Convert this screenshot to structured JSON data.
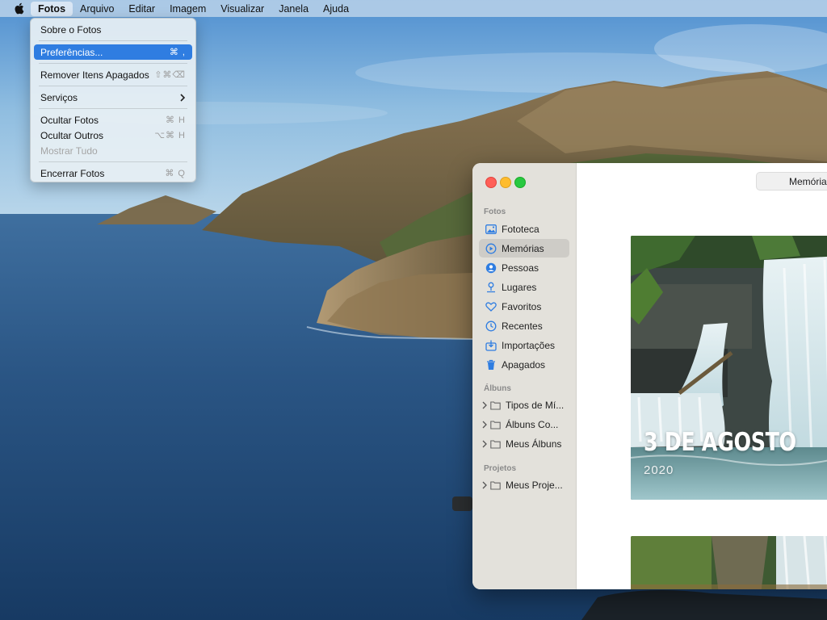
{
  "menubar": {
    "app_name": "Fotos",
    "items": [
      "Arquivo",
      "Editar",
      "Imagem",
      "Visualizar",
      "Janela",
      "Ajuda"
    ]
  },
  "app_menu": {
    "items": [
      {
        "label": "Sobre o Fotos",
        "shortcut": ""
      },
      {
        "label": "Preferências...",
        "shortcut": "⌘ ,",
        "state": "highlighted"
      },
      {
        "label": "Remover Itens Apagados",
        "shortcut": "⇧⌘⌫"
      },
      {
        "label": "Serviços",
        "submenu": true
      },
      {
        "label": "Ocultar Fotos",
        "shortcut": "⌘ H"
      },
      {
        "label": "Ocultar Outros",
        "shortcut": "⌥⌘ H"
      },
      {
        "label": "Mostrar Tudo",
        "shortcut": "",
        "state": "disabled"
      },
      {
        "label": "Encerrar Fotos",
        "shortcut": "⌘ Q"
      }
    ]
  },
  "sidebar": {
    "section_photos": "Fotos",
    "photos_items": [
      {
        "label": "Fototeca",
        "icon": "photo-library-icon"
      },
      {
        "label": "Memórias",
        "icon": "memories-icon",
        "selected": true
      },
      {
        "label": "Pessoas",
        "icon": "people-icon"
      },
      {
        "label": "Lugares",
        "icon": "places-pin-icon"
      },
      {
        "label": "Favoritos",
        "icon": "heart-icon"
      },
      {
        "label": "Recentes",
        "icon": "clock-icon"
      },
      {
        "label": "Importações",
        "icon": "import-icon"
      },
      {
        "label": "Apagados",
        "icon": "trash-icon"
      }
    ],
    "section_albums": "Álbuns",
    "album_items": [
      {
        "label": "Tipos de Mí...",
        "icon": "folder-icon"
      },
      {
        "label": "Álbuns Co...",
        "icon": "folder-icon"
      },
      {
        "label": "Meus Álbuns",
        "icon": "folder-icon"
      }
    ],
    "section_projects": "Projetos",
    "project_items": [
      {
        "label": "Meus Proje...",
        "icon": "folder-icon"
      }
    ]
  },
  "content": {
    "segmented_label": "Memórias",
    "memory_title": "3 DE AGOSTO",
    "memory_year": "2020"
  },
  "colors": {
    "menu_highlight": "#2f7de1",
    "traffic_red": "#ff5f57",
    "traffic_yellow": "#febc2e",
    "traffic_green": "#28c840",
    "sidebar_icon_blue": "#2f7de1"
  }
}
